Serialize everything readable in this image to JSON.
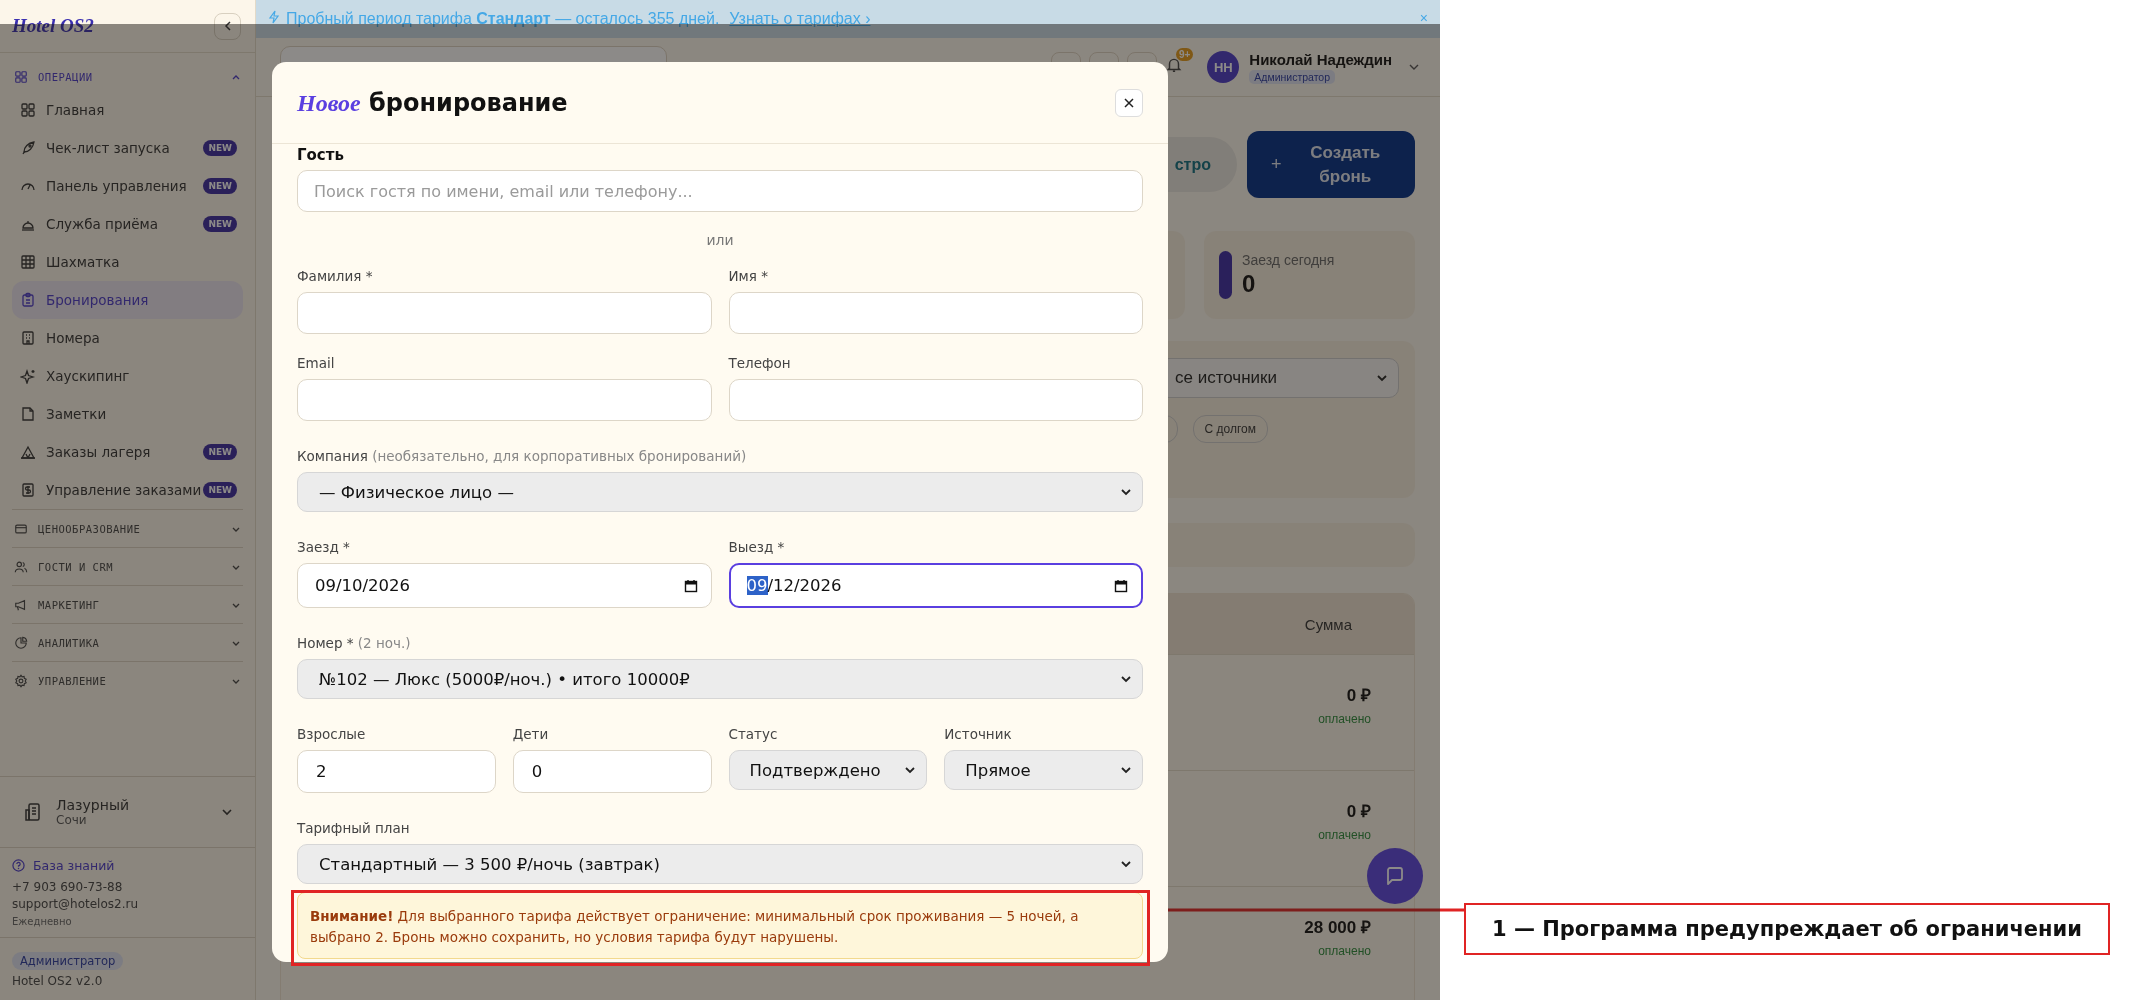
{
  "banner": {
    "text": "Пробный период тарифа **Стандарт** — осталось 355 дней.",
    "link": "Узнать о тарифах ›",
    "close": "×"
  },
  "sidebar": {
    "logo": "Hotel OS2",
    "sections": [
      {
        "label": "ОПЕРАЦИИ",
        "expanded": true,
        "items": [
          {
            "label": "Главная",
            "selected": false
          },
          {
            "label": "Чек-лист запуска",
            "selected": false,
            "badge": "NEW"
          },
          {
            "label": "Панель управления",
            "selected": false,
            "badge": "NEW"
          },
          {
            "label": "Служба приёма",
            "selected": false,
            "badge": "NEW"
          },
          {
            "label": "Шахматка",
            "selected": false
          },
          {
            "label": "Бронирования",
            "selected": true
          },
          {
            "label": "Номера",
            "selected": false
          },
          {
            "label": "Хаускипинг",
            "selected": false
          },
          {
            "label": "Заметки",
            "selected": false
          },
          {
            "label": "Заказы лагеря",
            "selected": false,
            "badge": "NEW"
          },
          {
            "label": "Управление заказами",
            "selected": false,
            "badge": "NEW"
          }
        ]
      },
      {
        "label": "ЦЕНООБРАЗОВАНИЕ",
        "expanded": false
      },
      {
        "label": "ГОСТИ И CRM",
        "expanded": false
      },
      {
        "label": "МАРКЕТИНГ",
        "expanded": false
      },
      {
        "label": "АНАЛИТИКА",
        "expanded": false
      },
      {
        "label": "УПРАВЛЕНИЕ",
        "expanded": false
      }
    ],
    "property": {
      "name": "Лазурный",
      "city": "Сочи"
    },
    "support": {
      "link": "База знаний",
      "phone": "+7 903 690-73-88",
      "email": "support@hotelos2.ru",
      "hours": "Ежедневно"
    },
    "role": "Администратор",
    "version": "Hotel OS2 v2.0"
  },
  "topbar": {
    "notifications": "9+",
    "user": {
      "initials": "НН",
      "name": "Николай Надеждин",
      "role": "Администратор"
    }
  },
  "page": {
    "buttons": [
      {
        "label": "стро",
        "kind": "secondary"
      },
      {
        "label": "Создать бронь",
        "kind": "primary",
        "icon": "+"
      }
    ],
    "stat": {
      "label": "Заезд сегодня",
      "value": "0"
    },
    "filters": {
      "source": "се источники",
      "chips": [
        "С долгом"
      ]
    },
    "table": {
      "columns": [
        "Сумма"
      ],
      "rows": [
        {
          "amount": "0 ₽",
          "payment": "оплачено"
        },
        {
          "amount": "0 ₽",
          "payment": "оплачено"
        },
        {
          "amount": "28 000 ₽",
          "payment": "оплачено"
        }
      ]
    }
  },
  "modal": {
    "title_accent": "Новое",
    "title": "бронирование",
    "section": "Гость",
    "guest_search": {
      "placeholder": "Поиск гостя по имени, email или телефону..."
    },
    "or": "или",
    "fields": [
      {
        "label": "Фамилия *"
      },
      {
        "label": "Имя *"
      },
      {
        "label": "Email"
      },
      {
        "label": "Телефон"
      }
    ],
    "company": {
      "label": "Компания",
      "hint": "(необязательно, для корпоративных бронирований)",
      "value": "— Физическое лицо —"
    },
    "dates": [
      {
        "label": "Заезд *",
        "focused": false,
        "segments": [
          {
            "text": "09/10/2026",
            "selected": false
          }
        ]
      },
      {
        "label": "Выезд *",
        "focused": true,
        "segments": [
          {
            "text": "09",
            "selected": true
          },
          {
            "text": "/12/2026",
            "selected": false
          }
        ]
      }
    ],
    "room": {
      "label": "Номер *",
      "hint": "(2 ноч.)",
      "value": "№102 — Люкс (5000₽/ноч.) • итого 10000₽"
    },
    "details": [
      {
        "label": "Взрослые",
        "kind": "input",
        "value": "2"
      },
      {
        "label": "Дети",
        "kind": "input",
        "value": "0"
      },
      {
        "label": "Статус",
        "kind": "select",
        "value": "Подтверждено"
      },
      {
        "label": "Источник",
        "kind": "select",
        "value": "Прямое"
      }
    ],
    "rate": {
      "label": "Тарифный план",
      "value": "Стандартный — 3 500 ₽/ночь (завтрак)"
    },
    "warning": "**Внимание!** Для выбранного тарифа действует ограничение: минимальный срок проживания — 5 ночей, а выбрано 2. Бронь можно сохранить, но условия тарифа будут нарушены."
  },
  "annotation": {
    "label": "1 — Программа предупреждает об ограничении"
  }
}
